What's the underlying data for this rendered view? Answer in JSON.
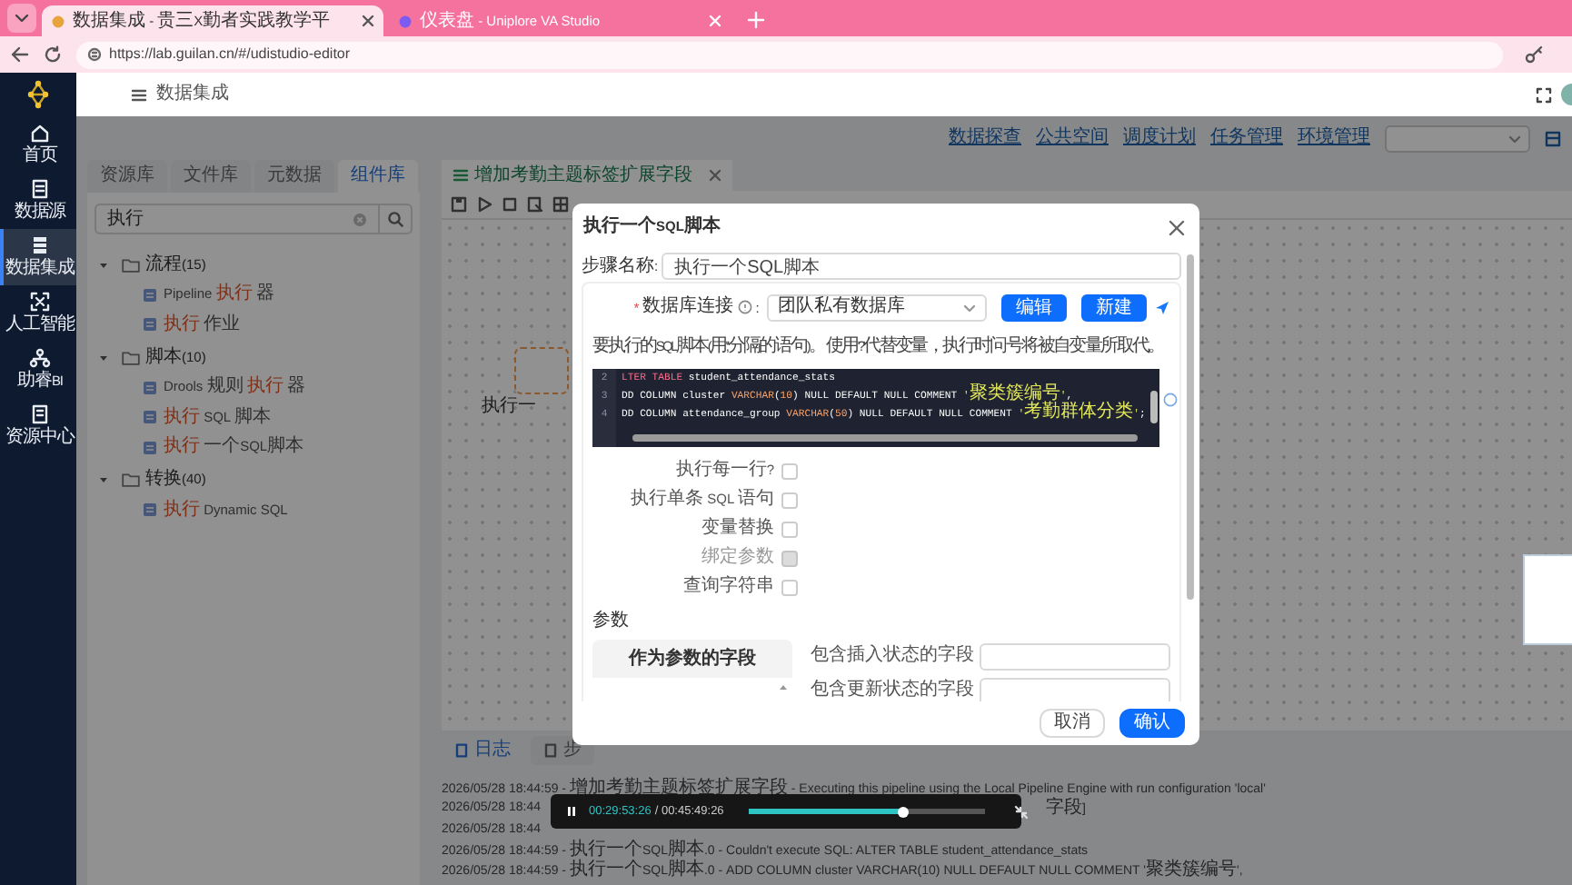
{
  "browser": {
    "tabs": [
      {
        "title": "数据集成 - 贵三X勤者实践教学平",
        "selected": true
      },
      {
        "title": "仪表盘 - Uniplore VA Studio",
        "selected": false
      }
    ],
    "url": "https://lab.guilan.cn/#/udistudio-editor"
  },
  "sidebar": {
    "items": [
      {
        "label": "首页",
        "selected": false
      },
      {
        "label": "数据源",
        "selected": false
      },
      {
        "label": "数据集成",
        "selected": true
      },
      {
        "label": "人工智能",
        "selected": false
      },
      {
        "label": "助睿BI",
        "selected": false
      },
      {
        "label": "资源中心",
        "selected": false
      }
    ]
  },
  "header": {
    "title": "数据集成"
  },
  "top_links": [
    "数据探查",
    "公共空间",
    "调度计划",
    "任务管理",
    "环境管理"
  ],
  "panel_tabs": [
    {
      "label": "资源库",
      "selected": false
    },
    {
      "label": "文件库",
      "selected": false
    },
    {
      "label": "元数据",
      "selected": false
    },
    {
      "label": "组件库",
      "selected": true
    }
  ],
  "search": {
    "value": "执行"
  },
  "tree": [
    {
      "label": "流程(15)",
      "expanded": true,
      "children": [
        {
          "parts": [
            {
              "text": "Pipeline ",
              "match": false
            },
            {
              "text": "执行",
              "match": true
            },
            {
              "text": " 器",
              "match": false
            }
          ]
        },
        {
          "parts": [
            {
              "text": "执行",
              "match": true
            },
            {
              "text": " 作业",
              "match": false
            }
          ]
        }
      ]
    },
    {
      "label": "脚本(10)",
      "expanded": true,
      "children": [
        {
          "parts": [
            {
              "text": "Drools 规则 ",
              "match": false
            },
            {
              "text": "执行",
              "match": true
            },
            {
              "text": " 器",
              "match": false
            }
          ]
        },
        {
          "parts": [
            {
              "text": "执行",
              "match": true
            },
            {
              "text": " SQL 脚本",
              "match": false
            }
          ]
        },
        {
          "parts": [
            {
              "text": "执行",
              "match": true
            },
            {
              "text": " 一个SQL脚本",
              "match": false
            }
          ]
        }
      ]
    },
    {
      "label": "转换(40)",
      "expanded": true,
      "children": [
        {
          "parts": [
            {
              "text": "执行",
              "match": true
            },
            {
              "text": " Dynamic SQL",
              "match": false
            }
          ]
        }
      ]
    }
  ],
  "editor": {
    "tab": "增加考勤主题标签扩展字段",
    "node_label": "执行一"
  },
  "bottom_tabs": [
    {
      "label": "日志",
      "selected": true
    },
    {
      "label": "步",
      "selected": false
    }
  ],
  "log": [
    {
      "text": "2026/05/28 18:44:59 - 增加考勤主题标签扩展字段 - Executing this pipeline using the Local Pipeline Engine with run configuration 'local'"
    },
    {
      "text": "2026/05/28 18:44",
      "tail": "字段]"
    },
    {
      "text": "2026/05/28 18:44"
    },
    {
      "text": "2026/05/28 18:44:59 - 执行一个SQL脚本.0 - Couldn't execute SQL: ALTER TABLE student_attendance_stats"
    },
    {
      "text": "2026/05/28 18:44:59 - 执行一个SQL脚本.0 - ADD COLUMN cluster VARCHAR(10) NULL DEFAULT NULL COMMENT '聚类簇编号',"
    }
  ],
  "dialog": {
    "title": "执行一个SQL脚本",
    "step_label": "步骤名称:",
    "step_name": "执行一个SQL脚本",
    "db": {
      "required": true,
      "required_mark": "*",
      "label": "数据库连接",
      "suffix": ":",
      "value": "团队私有数据库"
    },
    "buttons": [
      "编辑",
      "新建"
    ],
    "description": "要执行的SQL脚本(用';'分隔的语句)。 使用'?'代替变量，执行时问号将被自变量所取代。",
    "code_lines": [
      {
        "number": "2",
        "tokens": [
          {
            "text": "LTER TABLE",
            "kind": "keyword"
          },
          {
            "text": " student_attendance_stats",
            "kind": "plain"
          }
        ]
      },
      {
        "number": "3",
        "tokens": [
          {
            "text": "DD COLUMN cluster ",
            "kind": "plain"
          },
          {
            "text": "VARCHAR",
            "kind": "type"
          },
          {
            "text": "(",
            "kind": "plain"
          },
          {
            "text": "10",
            "kind": "number"
          },
          {
            "text": ") NULL DEFAULT NULL COMMENT ",
            "kind": "plain"
          },
          {
            "text": "'聚类簇编号'",
            "kind": "string"
          },
          {
            "text": ",",
            "kind": "plain"
          }
        ]
      },
      {
        "number": "4",
        "tokens": [
          {
            "text": "DD COLUMN attendance_group ",
            "kind": "plain"
          },
          {
            "text": "VARCHAR",
            "kind": "type"
          },
          {
            "text": "(",
            "kind": "plain"
          },
          {
            "text": "50",
            "kind": "number"
          },
          {
            "text": ") NULL DEFAULT NULL COMMENT ",
            "kind": "plain"
          },
          {
            "text": "'考勤群体分类'",
            "kind": "string"
          },
          {
            "text": ";",
            "kind": "plain"
          }
        ]
      }
    ],
    "options": [
      {
        "label": "执行每一行?",
        "checked": false,
        "disabled": false
      },
      {
        "label": "执行单条 SQL 语句",
        "checked": false,
        "disabled": false
      },
      {
        "label": "变量替换",
        "checked": false,
        "disabled": false
      },
      {
        "label": "绑定参数",
        "checked": false,
        "disabled": true
      },
      {
        "label": "查询字符串",
        "checked": false,
        "disabled": false
      }
    ],
    "params_label": "参数",
    "params_column": "作为参数的字段",
    "fields": [
      {
        "label": "包含插入状态的字段"
      },
      {
        "label": "包含更新状态的字段"
      }
    ],
    "footer": [
      {
        "label": "取消",
        "kind": "default"
      },
      {
        "label": "确认",
        "kind": "primary"
      }
    ]
  },
  "player": {
    "playing": true,
    "current": "00:29:53:26",
    "total": "/ 00:45:49:26",
    "level": 0.65
  }
}
